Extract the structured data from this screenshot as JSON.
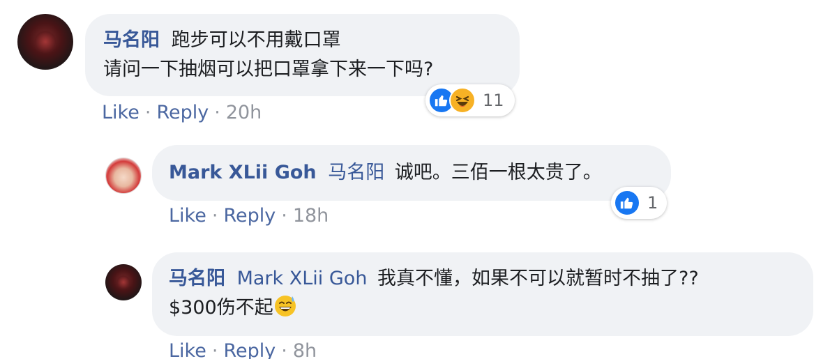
{
  "comments": [
    {
      "author": "马名阳",
      "mention": "",
      "line1": "跑步可以不用戴口罩",
      "line2": "请问一下抽烟可以把口罩拿下来一下吗?",
      "reactions": {
        "icons": [
          "like-icon",
          "haha-icon"
        ],
        "count": "11"
      },
      "actions": {
        "like": "Like",
        "reply": "Reply",
        "separator": "·",
        "time": "20h"
      }
    },
    {
      "author": "Mark XLii Goh",
      "mention": "马名阳",
      "line1": "诚吧。三佰一根太贵了。",
      "reactions": {
        "icons": [
          "like-icon"
        ],
        "count": "1"
      },
      "actions": {
        "like": "Like",
        "reply": "Reply",
        "separator": "·",
        "time": "18h"
      }
    },
    {
      "author": "马名阳",
      "mention": "Mark XLii Goh",
      "line1": "我真不懂，如果不可以就暂时不抽了??",
      "line2": "$300伤不起",
      "emoji": "sweat-smile-emoji",
      "actions": {
        "like": "Like",
        "reply": "Reply",
        "separator": "·",
        "time": "8h"
      }
    }
  ],
  "colors": {
    "name_blue": "#385898",
    "bubble_bg": "#f0f2f5",
    "like_blue": "#1877f2",
    "haha_yellow": "#f7b125",
    "meta_gray": "#90949c"
  }
}
